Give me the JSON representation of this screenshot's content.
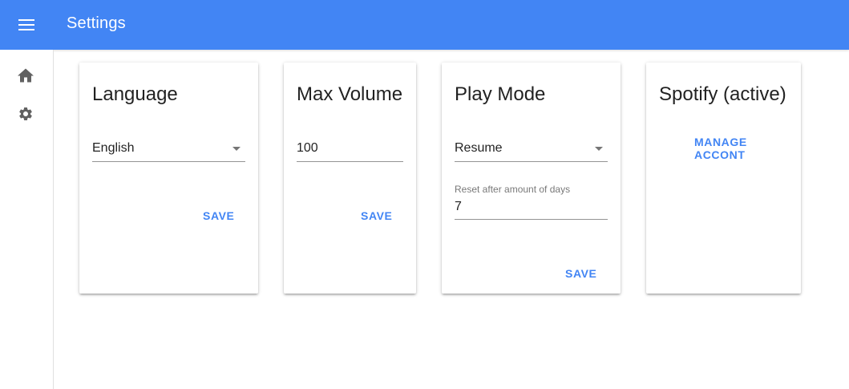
{
  "appbar": {
    "title": "Settings",
    "menu_icon": "menu-icon",
    "background": "#4285f4"
  },
  "sidenav": {
    "items": [
      {
        "icon": "home-icon"
      },
      {
        "icon": "gear-icon"
      }
    ]
  },
  "cards": {
    "language": {
      "title": "Language",
      "value": "English",
      "save_label": "SAVE"
    },
    "max_volume": {
      "title": "Max Volume",
      "value": "100",
      "save_label": "SAVE"
    },
    "play_mode": {
      "title": "Play Mode",
      "value": "Resume",
      "reset_label": "Reset after amount of days",
      "reset_value": "7",
      "save_label": "SAVE"
    },
    "spotify": {
      "title": "Spotify (active)",
      "manage_label": "MANAGE ACCONT"
    }
  },
  "colors": {
    "accent": "#4285f4"
  }
}
